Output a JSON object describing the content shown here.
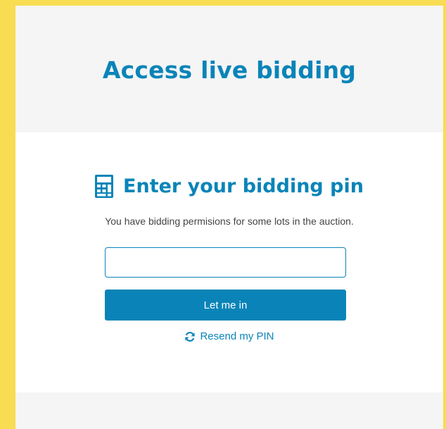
{
  "modal": {
    "title": "Access live bidding"
  },
  "pin_form": {
    "heading": "Enter your bidding pin",
    "description": "You have bidding permisions for some lots in the auction.",
    "pin_value": "",
    "pin_placeholder": "",
    "submit_label": "Let me in",
    "resend_label": "Resend my PIN"
  },
  "icons": {
    "heading_icon": "calculator-icon",
    "resend_icon": "refresh-icon"
  },
  "colors": {
    "background": "#f8dc52",
    "accent": "#0a84b8",
    "panel": "#f5f5f5",
    "body": "#ffffff"
  }
}
